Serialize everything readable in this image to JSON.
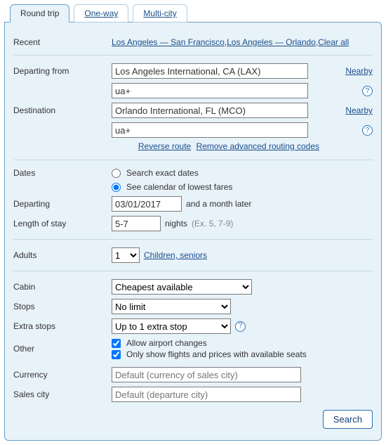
{
  "tabs": {
    "round": "Round trip",
    "oneway": "One-way",
    "multi": "Multi-city"
  },
  "recent": {
    "label": "Recent",
    "link1": "Los Angeles — San Francisco",
    "link2": "Los Angeles — Orlando",
    "clear": "Clear all",
    "sep": ", "
  },
  "dep": {
    "label": "Departing from",
    "airport": "Los Angeles International, CA (LAX)",
    "code": "ua+",
    "nearby": "Nearby"
  },
  "dest": {
    "label": "Destination",
    "airport": "Orlando International, FL (MCO)",
    "code": "ua+",
    "nearby": "Nearby"
  },
  "route": {
    "reverse": "Reverse route",
    "remove": "Remove advanced routing codes"
  },
  "dates": {
    "label": "Dates",
    "exact": "Search exact dates",
    "calendar": "See calendar of lowest fares"
  },
  "departing": {
    "label": "Departing",
    "value": "03/01/2017",
    "after": "and a month later"
  },
  "stay": {
    "label": "Length of stay",
    "value": "5-7",
    "nights": "nights",
    "ex": "(Ex. 5, 7-9)"
  },
  "adults": {
    "label": "Adults",
    "value": "1",
    "link": "Children, seniors"
  },
  "cabin": {
    "label": "Cabin",
    "value": "Cheapest available"
  },
  "stops": {
    "label": "Stops",
    "value": "No limit"
  },
  "extra": {
    "label": "Extra stops",
    "value": "Up to 1 extra stop"
  },
  "other": {
    "label": "Other",
    "allow": "Allow airport changes",
    "only": "Only show flights and prices with available seats"
  },
  "currency": {
    "label": "Currency",
    "placeholder": "Default (currency of sales city)"
  },
  "salescity": {
    "label": "Sales city",
    "placeholder": "Default (departure city)"
  },
  "search": "Search",
  "qmark": "?"
}
